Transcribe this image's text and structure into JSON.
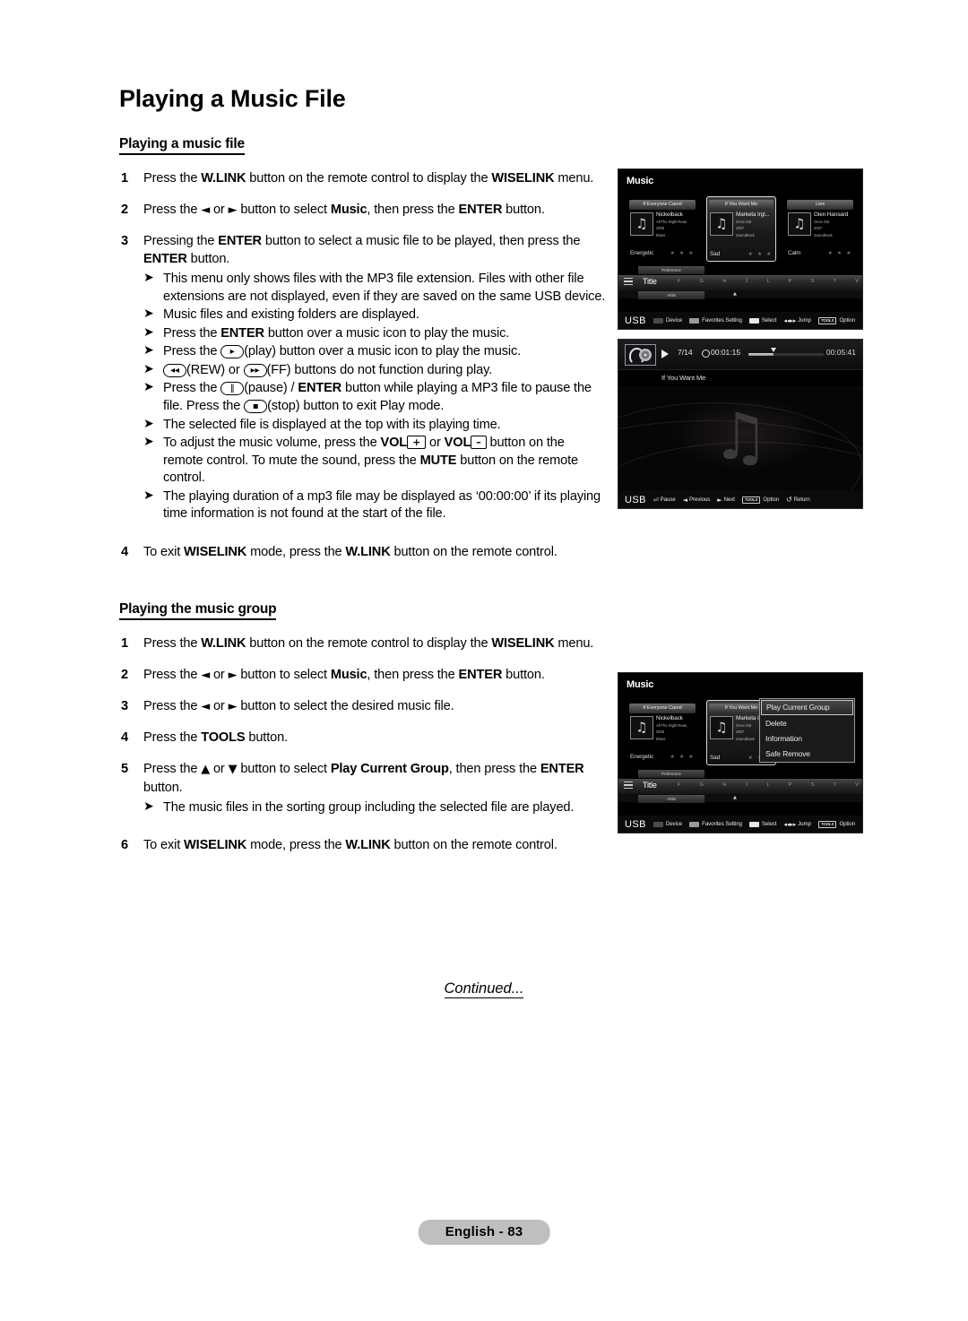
{
  "page": {
    "title": "Playing a Music File",
    "continued": "Continued...",
    "footer_badge": "English - 83"
  },
  "sections": [
    {
      "heading": "Playing a music file",
      "steps": [
        {
          "num": "1",
          "text_parts": [
            {
              "t": "Press the ",
              "b": false
            },
            {
              "t": "W.LINK",
              "b": true
            },
            {
              "t": " button on the remote control to display the ",
              "b": false
            },
            {
              "t": "WISELINK",
              "b": true
            },
            {
              "t": " menu.",
              "b": false
            }
          ]
        },
        {
          "num": "2",
          "text_parts": [
            {
              "t": "Press the ",
              "b": false
            },
            {
              "t": "◄",
              "b": false
            },
            {
              "t": " or ",
              "b": false
            },
            {
              "t": "►",
              "b": false
            },
            {
              "t": " button to select ",
              "b": false
            },
            {
              "t": "Music",
              "b": true
            },
            {
              "t": ", then press the ",
              "b": false
            },
            {
              "t": "ENTER",
              "b": true
            },
            {
              "t": " button.",
              "b": false
            }
          ]
        },
        {
          "num": "3",
          "text_parts": [
            {
              "t": "Pressing the ",
              "b": false
            },
            {
              "t": "ENTER",
              "b": true
            },
            {
              "t": " button to select a music file to be played, then press the ",
              "b": false
            },
            {
              "t": "ENTER",
              "b": true
            },
            {
              "t": " button.",
              "b": false
            }
          ],
          "bullets": [
            "This menu only shows files with the MP3 file extension. Files with other file extensions are not displayed, even if they are saved on the same USB device.",
            "Music files and existing folders are displayed.",
            "Press the ENTER button over a music icon to play the music.",
            "Press the (play) button over a music icon to play the music.",
            "(REW) or (FF) buttons do not function during play.",
            "Press the (pause) / ENTER button while playing a MP3 file to pause the file. Press the (stop) button to exit Play mode.",
            "The selected file is displayed at the top with its playing time.",
            "To adjust the music volume, press the VOL + or VOL - button on the remote control. To mute the sound, press the MUTE button on the remote control.",
            "The playing duration of a mp3 file may be displayed as ‘00:00:00’ if its playing time information is not found at the start of the file."
          ]
        },
        {
          "num": "4",
          "text_parts": [
            {
              "t": "To exit ",
              "b": false
            },
            {
              "t": "WISELINK",
              "b": true
            },
            {
              "t": " mode, press the ",
              "b": false
            },
            {
              "t": "W.LINK",
              "b": true
            },
            {
              "t": " button on the remote control.",
              "b": false
            }
          ]
        }
      ]
    },
    {
      "heading": "Playing the music group",
      "steps": [
        {
          "num": "1"
        },
        {
          "num": "2"
        },
        {
          "num": "3"
        },
        {
          "num": "4"
        },
        {
          "num": "5"
        },
        {
          "num": "6"
        }
      ]
    }
  ],
  "bullet_fragments": {
    "b1": "This menu only shows files with the MP3 file extension. Files with other file extensions are not displayed, even if they are saved on the same USB device.",
    "b2": "Music files and existing folders are displayed.",
    "b3_a": "Press the ",
    "b3_b": "ENTER",
    "b3_c": " button over a music icon to play the music.",
    "b4_a": "Press the ",
    "b4_b": "(play) button over a music icon to play the music.",
    "b5_a": "(REW) or ",
    "b5_b": "(FF) buttons do not function during play.",
    "b6_a": "Press the ",
    "b6_b": "(pause) / ",
    "b6_c": "ENTER",
    "b6_d": " button while playing a MP3 file to pause the file. Press the ",
    "b6_e": "(stop) button to exit Play mode.",
    "b7": "The selected file is displayed at the top with its playing time.",
    "b8_a": "To adjust the music volume, press the ",
    "b8_vol1": "VOL",
    "b8_plus": "+",
    "b8_or": " or ",
    "b8_vol2": "VOL",
    "b8_minus": "–",
    "b8_b": " button on the remote control. To mute the sound, press the ",
    "b8_mute": "MUTE",
    "b8_c": " button on the remote control.",
    "b9": "The playing duration of a mp3 file may be displayed as ‘00:00:00’ if its playing time information is not found at the start of the file.",
    "g5_bullet": "The music files in the sorting group including the selected file are played."
  },
  "step_text": {
    "s1_a": "Press the ",
    "s1_wlink": "W.LINK",
    "s1_b": " button on the remote control to display the ",
    "s1_wiselink": "WISELINK",
    "s1_c": " menu.",
    "s2_a": "Press the ",
    "s2_left": "◄",
    "s2_or": " or ",
    "s2_right": "►",
    "s2_b": " button to select ",
    "s2_music": "Music",
    "s2_c": ", then press the ",
    "s2_enter": "ENTER",
    "s2_d": " button.",
    "s3_a": "Pressing the ",
    "s3_enter1": "ENTER",
    "s3_b": " button to select a music file to be played, then press the ",
    "s3_enter2": "ENTER",
    "s3_c": " button.",
    "s4_a": "To exit ",
    "s4_wiselink": "WISELINK",
    "s4_b": " mode, press the ",
    "s4_wlink": "W.LINK",
    "s4_c": " button on the remote control.",
    "g3_a": "Press the ",
    "g3_left": "◄",
    "g3_or": " or ",
    "g3_right": "►",
    "g3_b": " button to select the desired music file.",
    "g4_a": "Press the ",
    "g4_tools": "TOOLS",
    "g4_b": " button.",
    "g5_a": "Press the ",
    "g5_up": "▲",
    "g5_or": " or ",
    "g5_down": "▼",
    "g5_b": " button to select ",
    "g5_play": "Play Current Group",
    "g5_c": ", then press the ",
    "g5_enter": "ENTER",
    "g5_d": " button.",
    "g6_a": "To exit ",
    "g6_wiselink": "WISELINK",
    "g6_b": " mode, press the ",
    "g6_wlink": "W.LINK",
    "g6_c": " button on the remote control."
  },
  "keycaps": {
    "play": "▸",
    "rew": "◂◂",
    "ff": "▸▸",
    "pause": "‖",
    "stop": "▪"
  },
  "tv_music_menu": {
    "title": "Music",
    "cards": [
      {
        "header": "If Everyone Cared",
        "artist": "Nickelback",
        "album": "All The Right Reas.",
        "year": "2005",
        "genre": "Blues",
        "mood": "Energetic",
        "stars": "★ ★ ★",
        "selected": false
      },
      {
        "header": "If You Want Me",
        "artist": "Marketa Irgl...",
        "album": "Once Ost",
        "year": "2007",
        "genre": "Soundtrack",
        "mood": "Sad",
        "stars": "★ ★ ★",
        "selected": true
      },
      {
        "header": "Lies",
        "artist": "Glen Hansard",
        "album": "Once Ost",
        "year": "2007",
        "genre": "Soundtrack",
        "mood": "Calm",
        "stars": "★ ★ ★",
        "selected": false
      }
    ],
    "sort": {
      "preference_tab": "Preference",
      "title_tab": "Title",
      "artist_tab": "Artist",
      "letters": [
        "F",
        "G",
        "H",
        "J",
        "L",
        "P",
        "S",
        "T",
        "V"
      ],
      "caret": "▲"
    },
    "guide": {
      "usb": "USB",
      "items": [
        {
          "label": "Device",
          "swatch": "#4a4a4a",
          "kind": "swatch"
        },
        {
          "label": "Favorites Setting",
          "swatch": "#9a9a9a",
          "kind": "swatch"
        },
        {
          "label": "Select",
          "swatch": "#e8e8e8",
          "kind": "swatch"
        },
        {
          "label": "Jump",
          "icon": "◂◂▸▸",
          "kind": "icon"
        },
        {
          "label": "Option",
          "chip": "TOOLS",
          "kind": "chip"
        }
      ]
    }
  },
  "tv_player": {
    "track_index": "7/14",
    "elapsed": "00:01:15",
    "total": "00:05:41",
    "now_playing": "If You Want Me",
    "progress_percent": 22,
    "guide": {
      "usb": "USB",
      "items": [
        {
          "label": "Pause",
          "icon": "⏎",
          "kind": "icon"
        },
        {
          "label": "Previous",
          "icon": "◄",
          "kind": "icon"
        },
        {
          "label": "Next",
          "icon": "►",
          "kind": "icon"
        },
        {
          "label": "Option",
          "chip": "TOOLS",
          "kind": "chip"
        },
        {
          "label": "Return",
          "icon": "↺",
          "kind": "icon"
        }
      ]
    }
  },
  "tv_tools_menu": {
    "title": "Music",
    "menu_items": [
      {
        "label": "Play Current Group",
        "selected": true
      },
      {
        "label": "Delete",
        "selected": false
      },
      {
        "label": "Information",
        "selected": false
      },
      {
        "label": "Safe Remove",
        "selected": false
      }
    ]
  }
}
